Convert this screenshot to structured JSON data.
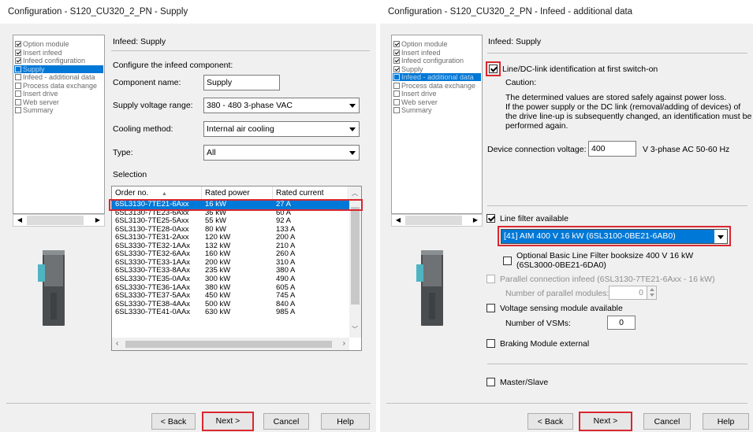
{
  "left": {
    "title": "Configuration - S120_CU320_2_PN - Supply",
    "nav": [
      {
        "label": "Option module",
        "checked": true
      },
      {
        "label": "Insert infeed",
        "checked": true
      },
      {
        "label": "Infeed configuration",
        "checked": true
      },
      {
        "label": "Supply",
        "checked": false,
        "selected": true
      },
      {
        "label": "Infeed - additional data",
        "checked": false
      },
      {
        "label": "Process data exchange",
        "checked": false
      },
      {
        "label": "Insert drive",
        "checked": false
      },
      {
        "label": "Web server",
        "checked": false
      },
      {
        "label": "Summary",
        "checked": false
      }
    ],
    "section_title": "Infeed: Supply",
    "instruction": "Configure the infeed component:",
    "component_name_label": "Component name:",
    "component_name_value": "Supply",
    "supply_voltage_label": "Supply voltage range:",
    "supply_voltage_value": "380 - 480 3-phase VAC",
    "cooling_label": "Cooling method:",
    "cooling_value": "Internal air cooling",
    "type_label": "Type:",
    "type_value": "All",
    "selection_label": "Selection",
    "table": {
      "headers": [
        "Order no.",
        "Rated power",
        "Rated current"
      ],
      "sort_indicator": "▲",
      "rows": [
        [
          "6SL3130-7TE21-6Axx",
          "16 kW",
          "27 A"
        ],
        [
          "6SL3130-7TE23-6Axx",
          "36 kW",
          "60 A"
        ],
        [
          "6SL3130-7TE25-5Axx",
          "55 kW",
          "92 A"
        ],
        [
          "6SL3130-7TE28-0Axx",
          "80 kW",
          "133 A"
        ],
        [
          "6SL3130-7TE31-2Axx",
          "120 kW",
          "200 A"
        ],
        [
          "6SL3330-7TE32-1AAx",
          "132 kW",
          "210 A"
        ],
        [
          "6SL3330-7TE32-6AAx",
          "160 kW",
          "260 A"
        ],
        [
          "6SL3330-7TE33-1AAx",
          "200 kW",
          "310 A"
        ],
        [
          "6SL3330-7TE33-8AAx",
          "235 kW",
          "380 A"
        ],
        [
          "6SL3330-7TE35-0AAx",
          "300 kW",
          "490 A"
        ],
        [
          "6SL3330-7TE36-1AAx",
          "380 kW",
          "605 A"
        ],
        [
          "6SL3330-7TE37-5AAx",
          "450 kW",
          "745 A"
        ],
        [
          "6SL3330-7TE38-4AAx",
          "500 kW",
          "840 A"
        ],
        [
          "6SL3330-7TE41-0AAx",
          "630 kW",
          "985 A"
        ]
      ],
      "selected_index": 0
    },
    "buttons": {
      "back": "< Back",
      "next": "Next >",
      "cancel": "Cancel",
      "help": "Help"
    }
  },
  "right": {
    "title": "Configuration - S120_CU320_2_PN - Infeed - additional data",
    "nav": [
      {
        "label": "Option module",
        "checked": true
      },
      {
        "label": "Insert infeed",
        "checked": true
      },
      {
        "label": "Infeed configuration",
        "checked": true
      },
      {
        "label": "Supply",
        "checked": true
      },
      {
        "label": "Infeed - additional data",
        "checked": false,
        "selected": true
      },
      {
        "label": "Process data exchange",
        "checked": false
      },
      {
        "label": "Insert drive",
        "checked": false
      },
      {
        "label": "Web server",
        "checked": false
      },
      {
        "label": "Summary",
        "checked": false
      }
    ],
    "section_title": "Infeed: Supply",
    "identification_label": "Line/DC-link identification at first switch-on",
    "caution_label": "Caution:",
    "caution_lines": [
      "The determined values are stored safely against power loss.",
      "If the power supply or the DC link (removal/adding of devices) of",
      "the drive line-up is subsequently changed, an identification must be",
      "performed again."
    ],
    "device_voltage_label": "Device connection voltage:",
    "device_voltage_value": "400",
    "device_voltage_unit": "V   3-phase AC  50-60 Hz",
    "line_filter_label": "Line filter available",
    "line_filter_value": "[41] AIM 400 V 16 kW (6SL3100-0BE21-6AB0)",
    "optional_filter_line1": "Optional  Basic Line Filter booksize 400 V 16 kW",
    "optional_filter_line2": "(6SL3000-0BE21-6DA0)",
    "parallel_label": "Parallel connection infeed (6SL3130-7TE21-6Axx - 16 kW)",
    "parallel_count_label": "Number of parallel modules:",
    "parallel_count_value": "0",
    "vsm_label": "Voltage sensing module available",
    "vsm_count_label": "Number of VSMs:",
    "vsm_count_value": "0",
    "braking_label": "Braking Module external",
    "master_slave_label": "Master/Slave",
    "buttons": {
      "back": "< Back",
      "next": "Next >",
      "cancel": "Cancel",
      "help": "Help"
    }
  }
}
